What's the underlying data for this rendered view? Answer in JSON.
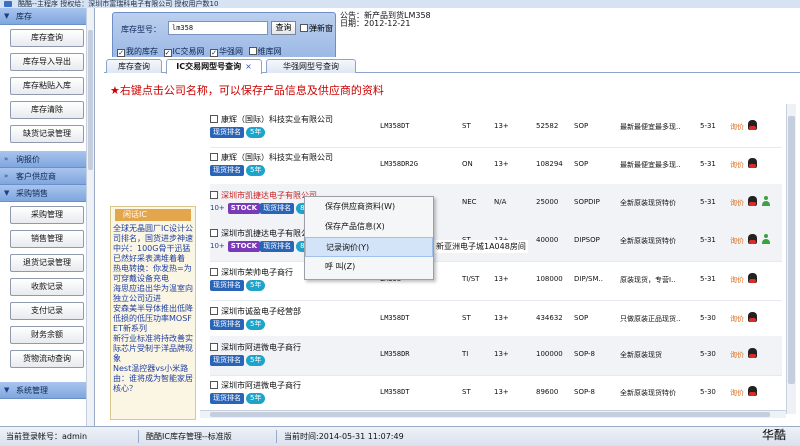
{
  "window": {
    "title": "酷酷--主程序 授权给：深圳市富瑞科电子有限公司 授权用户数10"
  },
  "sidebar": {
    "sections": [
      {
        "label": "库存",
        "expanded": true,
        "items": [
          "库存查询",
          "库存导入导出",
          "库存粘贴入库",
          "库存清除",
          "缺货记录管理"
        ]
      },
      {
        "label": "询报价",
        "expanded": false,
        "items": []
      },
      {
        "label": "客户供应商",
        "expanded": false,
        "items": []
      },
      {
        "label": "采购销售",
        "expanded": true,
        "items": [
          "采购管理",
          "销售管理",
          "退货记录管理",
          "收款记录",
          "支付记录",
          "财务余额",
          "货物流动查询"
        ]
      },
      {
        "label": "系统管理",
        "expanded": false,
        "items": []
      }
    ]
  },
  "search": {
    "label": "库存型号：",
    "value": "lm358",
    "query_button": "查询",
    "popup_label": "弹新窗",
    "checkboxes": [
      {
        "label": "我的库存",
        "checked": true
      },
      {
        "label": "IC交易网",
        "checked": true
      },
      {
        "label": "华强网",
        "checked": true
      },
      {
        "label": "维库网",
        "checked": false
      }
    ]
  },
  "announcement": {
    "line1": "公告：新产品到货LM358",
    "line2": "日期：2012-12-21"
  },
  "tabs": [
    {
      "label": "库存查询",
      "active": false,
      "closable": false
    },
    {
      "label": "IC交易网型号查询",
      "active": true,
      "closable": true
    },
    {
      "label": "华强网型号查询",
      "active": false,
      "closable": false
    }
  ],
  "hint": "★右键点击公司名称，可以保存产品信息及供应商的资料",
  "ad": {
    "header": "闲话IC",
    "lines": [
      "全球无晶圆厂IC设计公司排名，国货进步神速",
      "中兴：100G骨干迅猛已然好采表满堆着着",
      "热电转换：你发热=为可穿戴设备充电",
      "海思应追出华为温室向独立公司迈进",
      "安森美半导体推出低降低损的低压功率MOSFET新系列",
      "新行业标准将持改善实际芯片受制于洋品牌现象",
      "Nest温控器vs小米路由：谁将成为智能家居核心？"
    ]
  },
  "results": [
    {
      "company": "康辉（国际）科技实业有限公司",
      "rank": "现货排名",
      "years": "5年",
      "model": "LM358DT",
      "brand": "ST",
      "year": "13+",
      "qty": "52582",
      "pkg": "SOP",
      "note": "最新最便宜最多现..",
      "date": "5-31",
      "price": "询价",
      "stock": false,
      "red": false,
      "user": false
    },
    {
      "company": "康辉（国际）科技实业有限公司",
      "rank": "现货排名",
      "years": "5年",
      "model": "LM358DR2G",
      "brand": "ON",
      "year": "13+",
      "qty": "108294",
      "pkg": "SOP",
      "note": "最新最便宜最多现..",
      "date": "5-31",
      "price": "询价",
      "stock": false,
      "red": false,
      "user": false
    },
    {
      "company": "深圳市凯捷达电子有限公司",
      "rank": "现货排名",
      "years": "8年",
      "model": "LM358DT",
      "brand": "NEC",
      "year": "N/A",
      "qty": "25000",
      "pkg": "SOPDIP",
      "note": "全新原装现货特价",
      "date": "5-31",
      "price": "询价",
      "stock": true,
      "red": true,
      "user": true
    },
    {
      "company": "深圳市凯捷达电子有限公司",
      "rank": "现货排名",
      "years": "8年",
      "model": "LM358DT",
      "brand": "ST",
      "year": "13+",
      "qty": "40000",
      "pkg": "DIPSOP",
      "note": "全新原装现货特价",
      "date": "5-31",
      "price": "询价",
      "stock": true,
      "red": false,
      "user": true
    },
    {
      "company": "深圳市荣帅电子商行",
      "rank": "现货排名",
      "years": "5年",
      "model": "LM358",
      "brand": "TI/ST",
      "year": "13+",
      "qty": "108000",
      "pkg": "DIP/SM..",
      "note": "原装现货，专营I..",
      "date": "5-31",
      "price": "询价",
      "stock": false,
      "red": false,
      "user": false
    },
    {
      "company": "深圳市诚盈电子经营部",
      "rank": "现货排名",
      "years": "5年",
      "model": "LM358DT",
      "brand": "ST",
      "year": "13+",
      "qty": "434632",
      "pkg": "SOP",
      "note": "只做原装正品现货..",
      "date": "5-30",
      "price": "询价",
      "stock": false,
      "red": false,
      "user": false
    },
    {
      "company": "深圳市阿进微电子商行",
      "rank": "现货排名",
      "years": "5年",
      "model": "LM358DR",
      "brand": "TI",
      "year": "13+",
      "qty": "100000",
      "pkg": "SOP-8",
      "note": "全新原装现货",
      "date": "5-30",
      "price": "询价",
      "stock": false,
      "red": false,
      "user": false
    },
    {
      "company": "深圳市阿进微电子商行",
      "rank": "现货排名",
      "years": "5年",
      "model": "LM358DT",
      "brand": "ST",
      "year": "13+",
      "qty": "89600",
      "pkg": "SOP-8",
      "note": "全新原装现货特价",
      "date": "5-30",
      "price": "询价",
      "stock": false,
      "red": false,
      "user": false
    }
  ],
  "context_menu": {
    "items": [
      "保存供应商资料(W)",
      "保存产品信息(X)",
      "记录询价(Y)",
      "呼 叫(Z)"
    ],
    "highlighted": 2
  },
  "address_snippet": "新亚洲电子城1A048房间",
  "status": {
    "user": "当前登录帐号：admin",
    "app": "酷酷IC库存管理--标准版",
    "time": "当前时间:2014-05-31 11:07:49",
    "brand": "华酷"
  },
  "colors": {
    "accent": "#2a64b8",
    "hint": "#cc0000",
    "price": "#d96b1a"
  }
}
